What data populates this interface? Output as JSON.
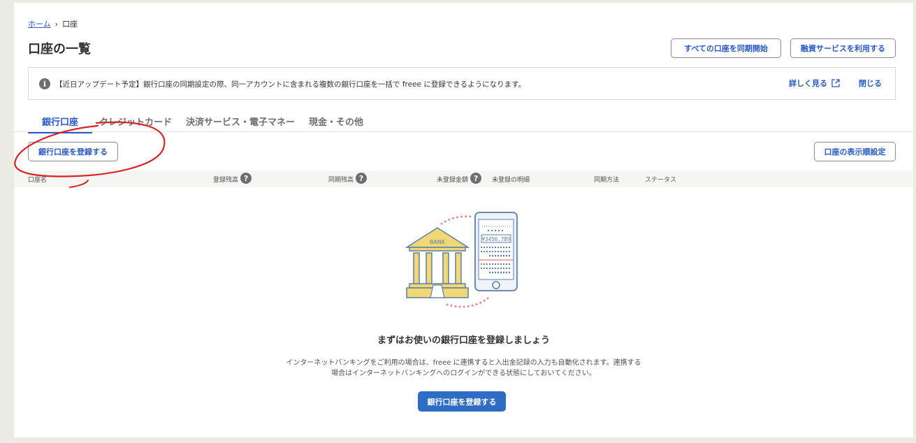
{
  "breadcrumb": {
    "home": "ホーム",
    "current": "口座"
  },
  "page": {
    "title": "口座の一覧"
  },
  "header_buttons": {
    "sync_all": "すべての口座を同期開始",
    "finance": "融資サービスを利用する"
  },
  "notice": {
    "text": "【近日アップデート予定】銀行口座の同期設定の際、同一アカウントに含まれる複数の銀行口座を一括で freee に登録できるようになります。",
    "details": "詳しく見る",
    "close": "閉じる"
  },
  "tabs": [
    {
      "label": "銀行口座",
      "active": true
    },
    {
      "label": "クレジットカード",
      "active": false
    },
    {
      "label": "決済サービス・電子マネー",
      "active": false
    },
    {
      "label": "現金・その他",
      "active": false
    }
  ],
  "actions": {
    "register": "銀行口座を登録する",
    "order": "口座の表示順設定"
  },
  "table": {
    "columns": [
      {
        "label": "口座名",
        "help": false
      },
      {
        "label": "登録残高",
        "help": true
      },
      {
        "label": "同期残高",
        "help": true
      },
      {
        "label": "未登録金額",
        "help": true
      },
      {
        "label": "未登録の明細",
        "help": false
      },
      {
        "label": "同期方法",
        "help": false
      },
      {
        "label": "ステータス",
        "help": false
      }
    ],
    "help_glyph": "?"
  },
  "empty_state": {
    "illustration": {
      "bank_sign": "BANK",
      "amount": "¥3456,789"
    },
    "title": "まずはお使いの銀行口座を登録しましょう",
    "desc_line1": "インターネットバンキングをご利用の場合は、freee に連携すると入出金記録の入力も自動化されます。連携する",
    "desc_line2": "場合はインターネットバンキングへのログインができる状態にしておいてください。",
    "button": "銀行口座を登録する"
  },
  "icons": {
    "info": "info-icon",
    "external": "external-link-icon",
    "help": "question-icon"
  },
  "colors": {
    "accent": "#285ac8",
    "primary_button": "#2f6cc6",
    "annotation": "#d92323",
    "bank_yellow": "#f2d775"
  },
  "info_glyph": "i"
}
